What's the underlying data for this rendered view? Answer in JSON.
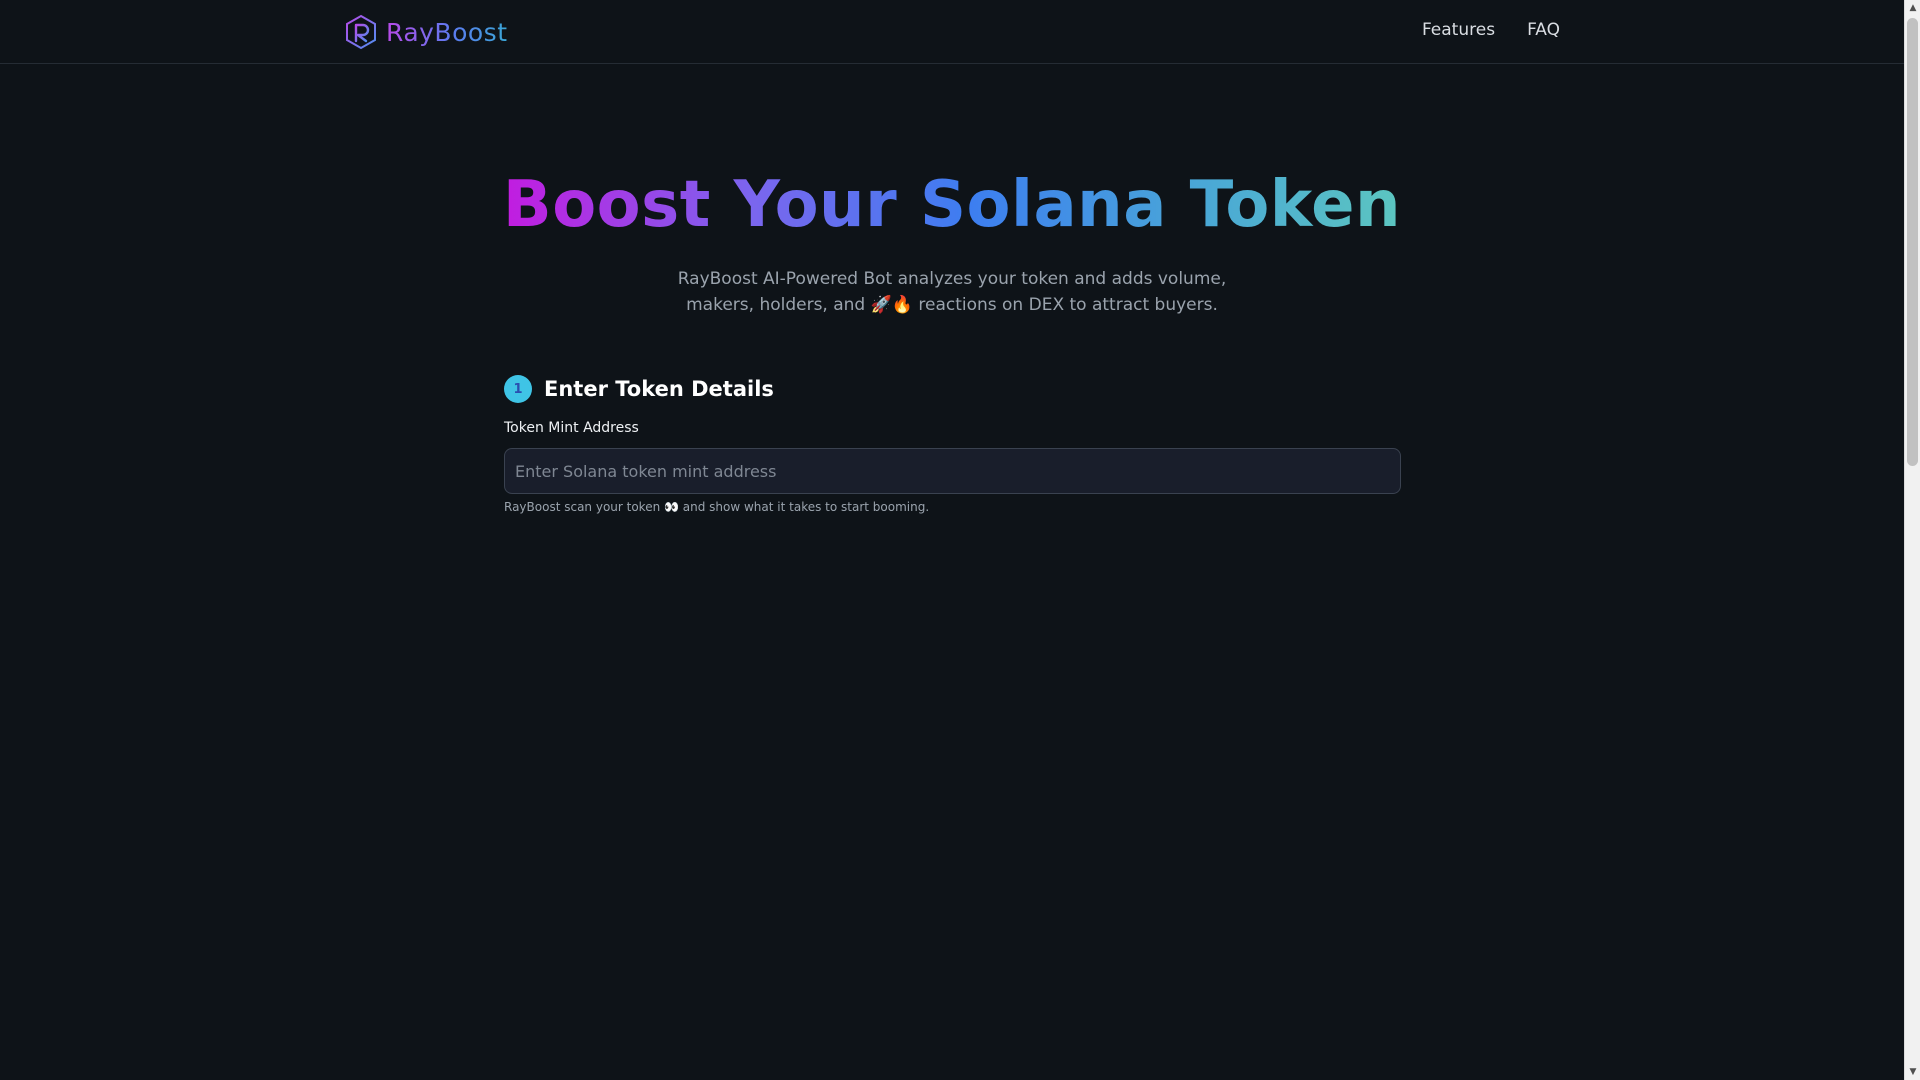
{
  "header": {
    "brand_name": "RayBoost",
    "logo_icon": "hexagon-r-logo-icon",
    "nav": [
      {
        "label": "Features"
      },
      {
        "label": "FAQ"
      }
    ]
  },
  "hero": {
    "title": "Boost Your Solana Token",
    "subtitle_line1": "RayBoost AI-Powered Bot analyzes your token and adds volume,",
    "subtitle_line2": "makers, holders, and 🚀🔥 reactions on DEX to attract buyers."
  },
  "step": {
    "number": "1",
    "title": "Enter Token Details",
    "field_label": "Token Mint Address",
    "input_value": "",
    "input_placeholder": "Enter Solana token mint address",
    "hint": "RayBoost scan your token 👀 and show what it takes to start booming."
  },
  "colors": {
    "background": "#0e1318",
    "accent_purple": "#c21ce0",
    "accent_blue": "#3d7ef0",
    "accent_teal": "#5cc6c0",
    "step_badge": "#3fc4e6"
  }
}
